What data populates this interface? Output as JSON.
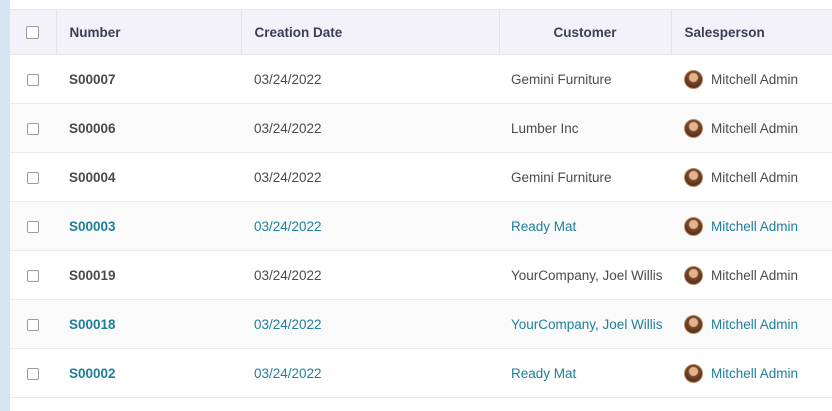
{
  "columns": {
    "number": "Number",
    "creation_date": "Creation Date",
    "customer": "Customer",
    "salesperson": "Salesperson"
  },
  "rows": [
    {
      "number": "S00007",
      "date": "03/24/2022",
      "customer": "Gemini Furniture",
      "salesperson": "Mitchell Admin"
    },
    {
      "number": "S00006",
      "date": "03/24/2022",
      "customer": "Lumber Inc",
      "salesperson": "Mitchell Admin"
    },
    {
      "number": "S00004",
      "date": "03/24/2022",
      "customer": "Gemini Furniture",
      "salesperson": "Mitchell Admin"
    },
    {
      "number": "S00003",
      "date": "03/24/2022",
      "customer": "Ready Mat",
      "salesperson": "Mitchell Admin"
    },
    {
      "number": "S00019",
      "date": "03/24/2022",
      "customer": "YourCompany, Joel Willis",
      "salesperson": "Mitchell Admin"
    },
    {
      "number": "S00018",
      "date": "03/24/2022",
      "customer": "YourCompany, Joel Willis",
      "salesperson": "Mitchell Admin"
    },
    {
      "number": "S00002",
      "date": "03/24/2022",
      "customer": "Ready Mat",
      "salesperson": "Mitchell Admin"
    }
  ],
  "colors": {
    "link": "#1f7f9a",
    "header_bg": "#f3f2fb",
    "side_strip": "#d5e6f2"
  }
}
